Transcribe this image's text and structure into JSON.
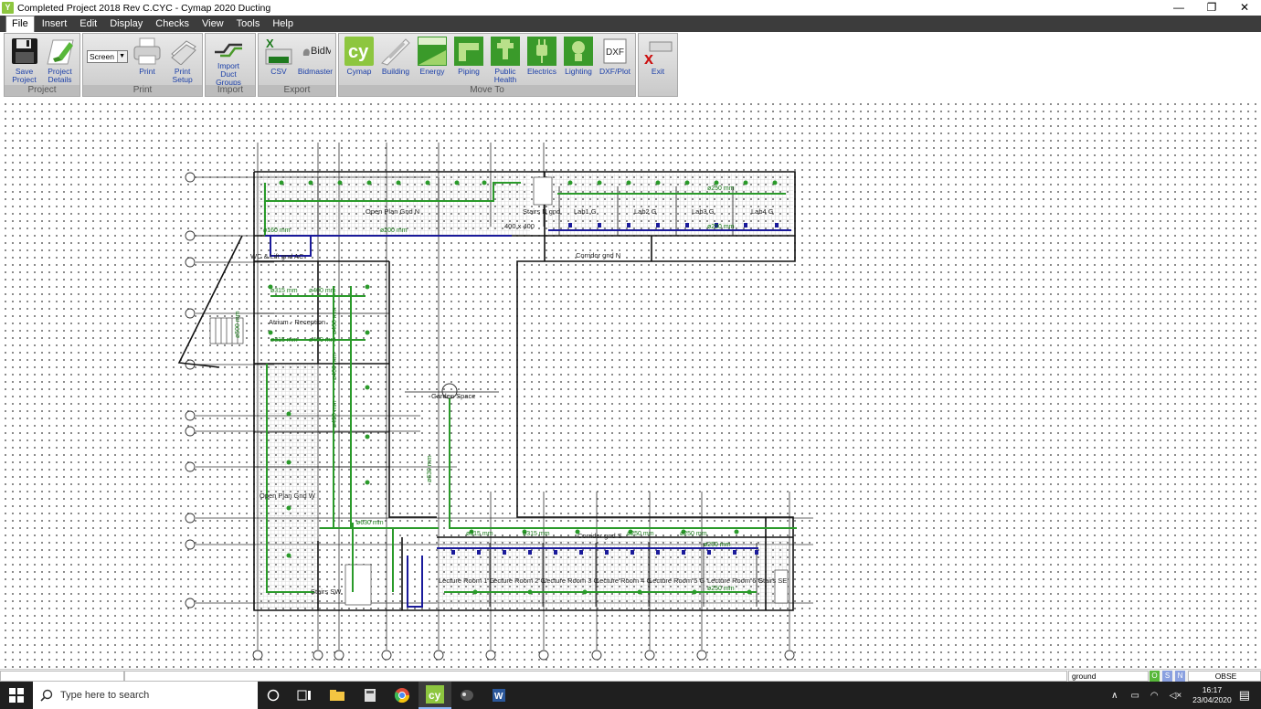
{
  "window": {
    "title": "Completed Project 2018 Rev C.CYC - Cymap 2020 Ducting",
    "app_icon_letter": "Y",
    "minimize": "—",
    "maximize": "❐",
    "close": "✕"
  },
  "menu": {
    "items": [
      "File",
      "Insert",
      "Edit",
      "Display",
      "Checks",
      "View",
      "Tools",
      "Help"
    ],
    "active": "File"
  },
  "ribbon": {
    "groups": {
      "project": {
        "label": "Project",
        "save": "Save\nProject",
        "details": "Project\nDetails"
      },
      "print": {
        "label": "Print",
        "select_value": "Screen",
        "print": "Print",
        "print_setup": "Print\nSetup"
      },
      "import": {
        "label": "Import",
        "import_duct_groups": "Import\nDuct Groups"
      },
      "export": {
        "label": "Export",
        "csv": "CSV",
        "bidmaster": "Bidmaster",
        "csv_icon_text": "CSV",
        "bidm_icon_text": "BidM"
      },
      "moveto": {
        "label": "Move To",
        "cymap": "Cymap",
        "building": "Building",
        "energy": "Energy",
        "piping": "Piping",
        "public_health": "Public\nHealth",
        "electrics": "Electrics",
        "lighting": "Lighting",
        "dxf": "DXF/Plot",
        "dxf_icon_text": "DXF",
        "cymap_icon_text": "cy"
      },
      "exit": {
        "exit": "Exit"
      }
    }
  },
  "plan": {
    "rooms": {
      "open_plan_n": "Open Plan Gnd N",
      "stairs_n": "Stairs N gnd",
      "lab1": "Lab1 G",
      "lab2": "Lab2 G",
      "lab3": "Lab3 G",
      "lab4": "Lab4 G",
      "corridor_n": "Corridor gnd N",
      "wc": "WC & Lift gnd AC",
      "atrium": "Atrium - Reception",
      "garden": "Garden Space",
      "open_plan_w": "Open Plan Gnd W",
      "corridor_s": "Corridor gnd S",
      "lecture1": "Lecture Room 1 G",
      "lecture2": "Lecture Room 2 G",
      "lecture3": "Lecture Room 3 G",
      "lecture4": "Lecture Room 4 G",
      "lecture5": "Lecture Room 5 G",
      "lecture6": "Lecture Room 6 G",
      "stairs_se": "Stairs SE",
      "stairs_sw": "Stairs SW"
    },
    "duct_labels": {
      "d160": "ø160 mm",
      "d200": "ø200 mm",
      "d250a": "ø250 mm",
      "d250b": "ø250 mm",
      "rect": "400 x 400",
      "d315a": "ø315 mm",
      "d400a": "ø400 mm",
      "d315b": "ø315 mm",
      "d400b": "ø400 mm",
      "d630v": "ø630 mm",
      "d630h": "ø630 mm",
      "d315c": "ø315 mm",
      "d315d": "ø315 mm",
      "d250c": "ø250 mm",
      "d250d": "ø250 mm",
      "d250e": "ø250 mm",
      "d250f": "ø250 mm",
      "d500": "ø500 mm",
      "d400v": "ø400 mm",
      "d400v2": "ø400 mm",
      "d450v": "ø450 mm"
    }
  },
  "status": {
    "layer": "ground",
    "toggles": [
      "O",
      "S",
      "N"
    ],
    "mode": "OBSE"
  },
  "taskbar": {
    "search_placeholder": "Type here to search",
    "time": "16:17",
    "date": "23/04/2020"
  },
  "colors": {
    "duct_green": "#2a9a2a",
    "terminal_blue": "#1a1a9a",
    "ribbon_label": "#1b3fa8"
  }
}
